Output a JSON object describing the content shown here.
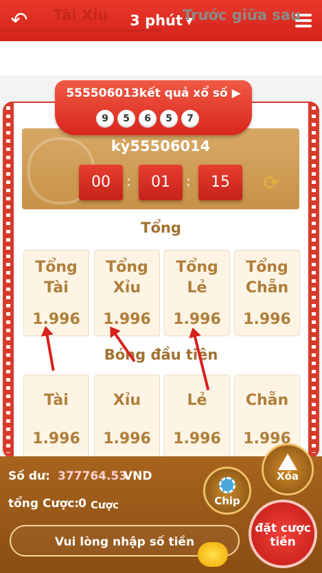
{
  "header": {
    "title": "3 phút",
    "back_icon": "back-arrow-icon",
    "menu_icon": "hamburger-menu-icon"
  },
  "tabs": [
    {
      "label": "Tài Xỉu",
      "active": true
    },
    {
      "label": "Trước giữa sau",
      "active": false
    }
  ],
  "result": {
    "label": "555506013kết quả xổ số",
    "numbers": [
      "9",
      "5",
      "6",
      "5",
      "7"
    ]
  },
  "countdown": {
    "period": "kỳ55506014",
    "hours": "00",
    "minutes": "01",
    "seconds": "15",
    "refresh_icon": "refresh-icon"
  },
  "section_total": {
    "title": "Tổng",
    "cards": [
      {
        "line1": "Tổng",
        "line2": "Tài",
        "odds": "1.996"
      },
      {
        "line1": "Tổng",
        "line2": "Xỉu",
        "odds": "1.996"
      },
      {
        "line1": "Tổng",
        "line2": "Lẻ",
        "odds": "1.996"
      },
      {
        "line1": "Tổng",
        "line2": "Chẵn",
        "odds": "1.996"
      }
    ]
  },
  "section_first": {
    "title": "Bóng đầu tiên",
    "cards": [
      {
        "label": "Tài",
        "odds": "1.996"
      },
      {
        "label": "Xỉu",
        "odds": "1.996"
      },
      {
        "label": "Lẻ",
        "odds": "1.996"
      },
      {
        "label": "Chẵn",
        "odds": "1.996"
      }
    ]
  },
  "footer": {
    "balance_label": "Số dư:",
    "balance_value": "377764.53",
    "balance_currency": "VND",
    "bet_label": "tổng Cược:",
    "bet_count": "0",
    "bet_unit": "Cược",
    "amount_placeholder": "Vui lòng nhập số tiền",
    "chip_label": "Chip",
    "clear_label": "Xóa",
    "place_label": "đặt cược tiền"
  },
  "colors": {
    "primary_red": "#d4241c",
    "gold": "#c89248",
    "card_text": "#b07e3a"
  }
}
